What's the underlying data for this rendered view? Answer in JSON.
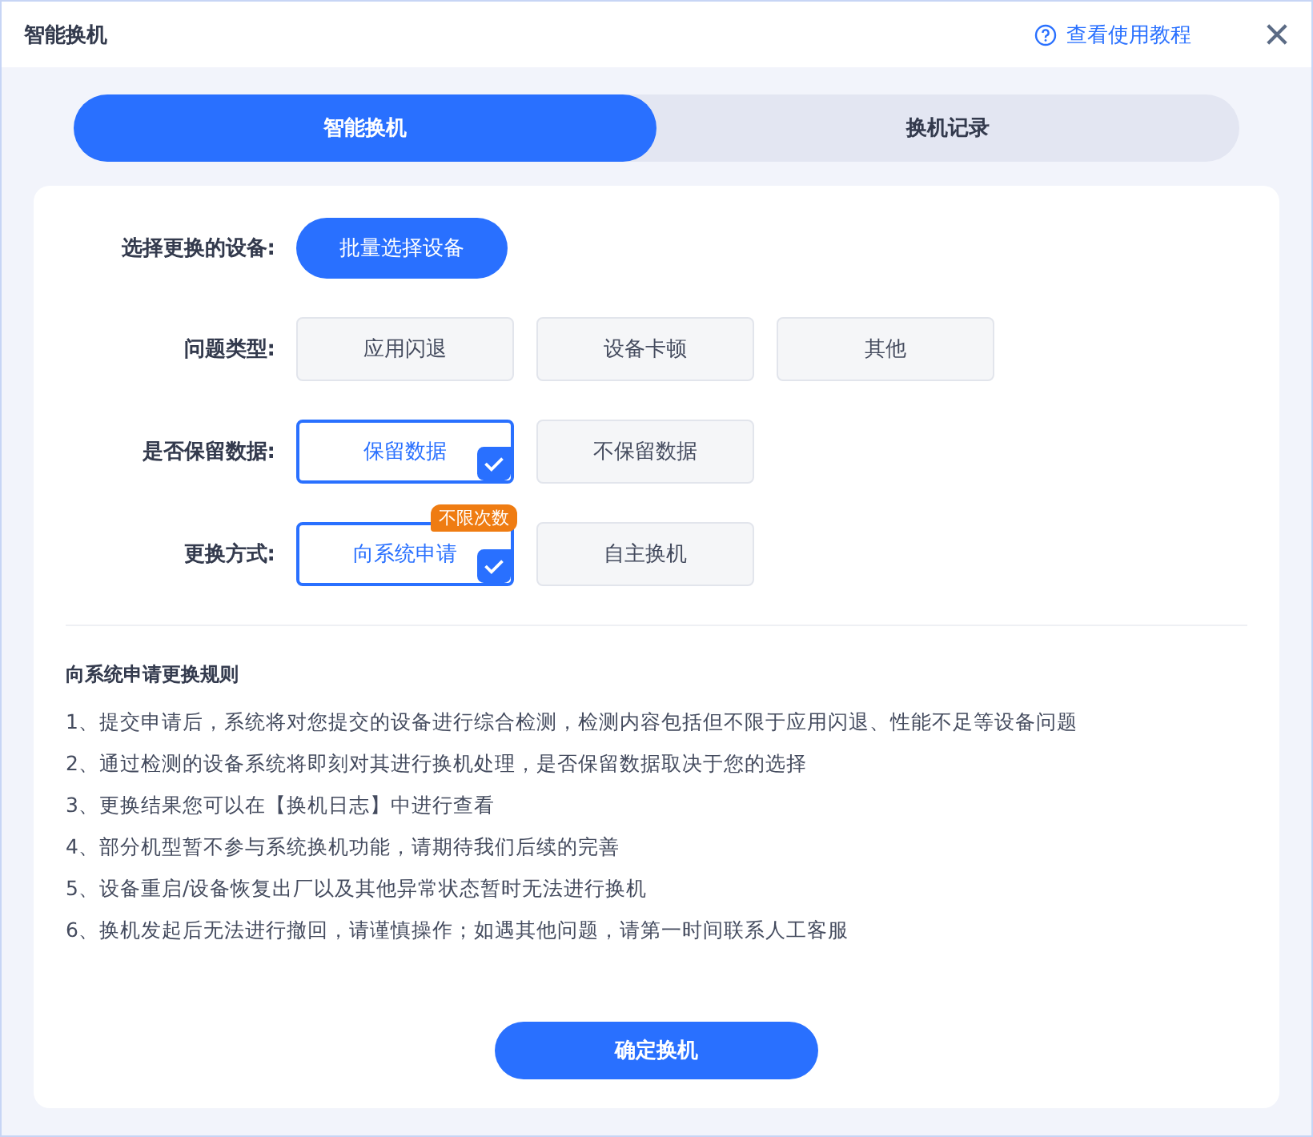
{
  "window": {
    "title": "智能换机",
    "help_link": "查看使用教程"
  },
  "tabs": [
    {
      "label": "智能换机",
      "selected": true
    },
    {
      "label": "换机记录",
      "selected": false
    }
  ],
  "form": [
    {
      "label": "选择更换的设备:",
      "kind": "button",
      "button": "批量选择设备"
    },
    {
      "label": "问题类型:",
      "kind": "options",
      "options": [
        {
          "label": "应用闪退",
          "selected": false
        },
        {
          "label": "设备卡顿",
          "selected": false
        },
        {
          "label": "其他",
          "selected": false
        }
      ]
    },
    {
      "label": "是否保留数据:",
      "kind": "options",
      "options": [
        {
          "label": "保留数据",
          "selected": true
        },
        {
          "label": "不保留数据",
          "selected": false
        }
      ]
    },
    {
      "label": "更换方式:",
      "kind": "options",
      "options": [
        {
          "label": "向系统申请",
          "selected": true,
          "badge": "不限次数"
        },
        {
          "label": "自主换机",
          "selected": false
        }
      ]
    }
  ],
  "rules": {
    "title": "向系统申请更换规则",
    "items": [
      "1、提交申请后，系统将对您提交的设备进行综合检测，检测内容包括但不限于应用闪退、性能不足等设备问题",
      "2、通过检测的设备系统将即刻对其进行换机处理，是否保留数据取决于您的选择",
      "3、更换结果您可以在【换机日志】中进行查看",
      "4、部分机型暂不参与系统换机功能，请期待我们后续的完善",
      "5、设备重启/设备恢复出厂以及其他异常状态暂时无法进行换机",
      "6、换机发起后无法进行撤回，请谨慎操作；如遇其他问题，请第一时间联系人工客服"
    ]
  },
  "confirm_button": "确定换机"
}
